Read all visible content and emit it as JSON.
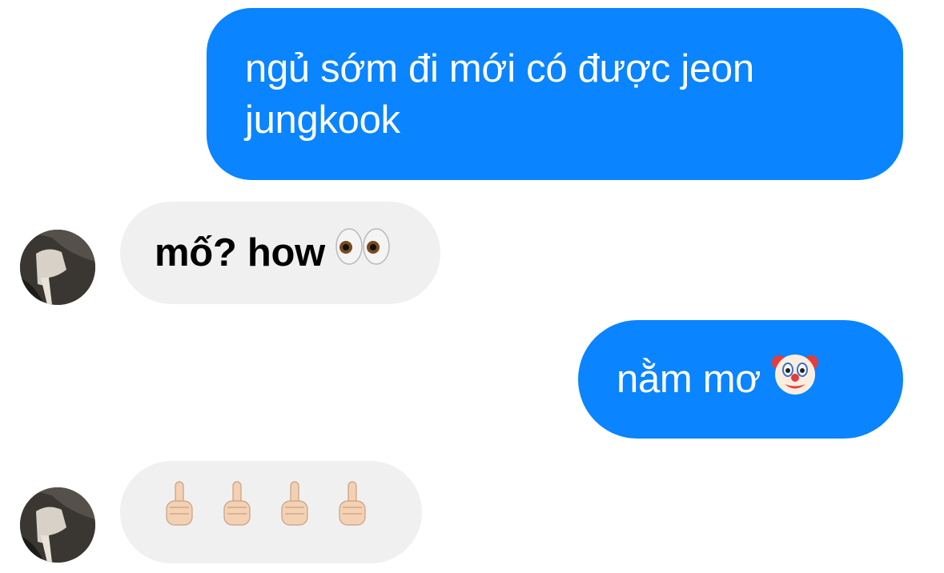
{
  "thread": {
    "messages": [
      {
        "direction": "sent",
        "text": "ngủ sớm đi mới có được jeon jungkook"
      },
      {
        "direction": "received",
        "text": "mố? how",
        "emoji": "eyes-emoji"
      },
      {
        "direction": "sent",
        "text": "nằm mơ",
        "emoji": "clown-face-emoji"
      },
      {
        "direction": "received",
        "emoji": [
          "middle-finger-emoji",
          "middle-finger-emoji",
          "middle-finger-emoji",
          "middle-finger-emoji"
        ]
      }
    ]
  },
  "colors": {
    "sent_bubble": "#0A84FF",
    "received_bubble": "#F0F0F0",
    "sent_text": "#FFFFFF",
    "received_text": "#000000"
  }
}
